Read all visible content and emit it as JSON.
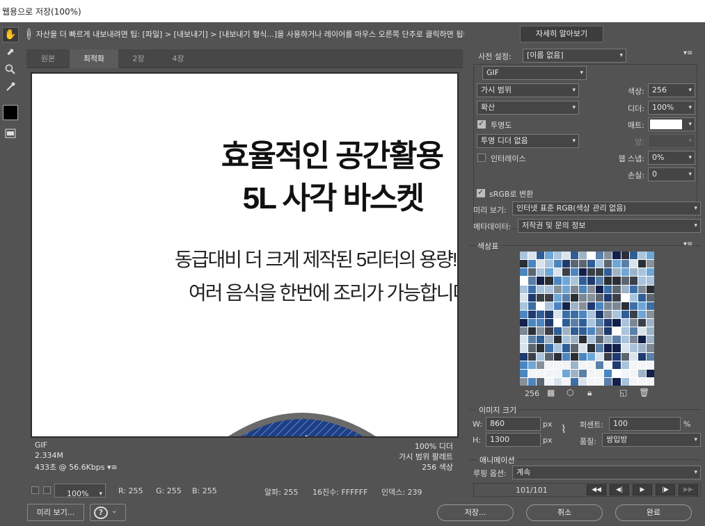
{
  "window": {
    "title": "웹용으로 저장(100%)"
  },
  "tip": {
    "text": "자산을 더 빠르게 내보내려면 팁: [파일] > [내보내기] > [내보내기 형식...]을 사용하거나 레이어를 마우스 오른쪽 단추로 클릭하면 됩니다.",
    "learn_more": "자세히 알아보기"
  },
  "tabs": [
    "원본",
    "최적화",
    "2장",
    "4장"
  ],
  "canvas": {
    "line1": "효율적인 공간활용",
    "line2": "5L 사각 바스켓",
    "line3": "동급대비 더 크게 제작된 5리터의 용량!",
    "line4": "여러 음식을 한번에 조리가 가능합니다"
  },
  "canvas_footer": {
    "format": "GIF",
    "size": "2.334M",
    "time": "433초 @ 56.6Kbps",
    "dither": "100% 디더",
    "palette": "가시 범위 팔레트",
    "colors": "256 색상"
  },
  "status": {
    "zoom": "100%",
    "r": "R: 255",
    "g": "G: 255",
    "b": "B: 255",
    "alpha": "알파: 255",
    "hex": "16진수: FFFFFF",
    "index": "인덱스: 239"
  },
  "settings": {
    "preset_label": "사전 설정:",
    "preset_value": "[이름 없음]",
    "format": "GIF",
    "reduction": "가시 범위",
    "dither_algo": "확산",
    "colors_label": "색상:",
    "colors_value": "256",
    "dither_label": "디더:",
    "dither_value": "100%",
    "transparency_label": "투명도",
    "matte_label": "매트:",
    "trans_dither": "투명 디더 없음",
    "amount_label": "양:",
    "interlace_label": "인터레이스",
    "websnap_label": "웹 스냅:",
    "websnap_value": "0%",
    "lossy_label": "손실:",
    "lossy_value": "0",
    "srgb_label": "sRGB로 변환",
    "preview_label": "미리 보기:",
    "preview_value": "인터넷 표준 RGB(색상 관리 없음)",
    "metadata_label": "메타데이터:",
    "metadata_value": "저작권 및 문의 정보"
  },
  "color_table": {
    "title": "색상표",
    "count": "256"
  },
  "image_size": {
    "title": "이미지 크기",
    "w_label": "W:",
    "w_value": "860",
    "h_label": "H:",
    "h_value": "1300",
    "unit": "px",
    "percent_label": "퍼센트:",
    "percent_value": "100",
    "percent_unit": "%",
    "quality_label": "품질:",
    "quality_value": "쌍입방"
  },
  "animation": {
    "title": "애니메이션",
    "loop_label": "루핑 옵션:",
    "loop_value": "계속",
    "frame": "101/101"
  },
  "buttons": {
    "preview": "미리 보기...",
    "save": "저장...",
    "cancel": "취소",
    "done": "완료"
  },
  "palette_colors": [
    "#1e3a6e",
    "#2f5e96",
    "#4b86c0",
    "#6ea7d6",
    "#87919c",
    "#3a3f48",
    "#5a7fa8",
    "#a9c4dc",
    "#d9e3ec",
    "#ffffff",
    "#2a2e35",
    "#7b8794",
    "#12204a",
    "#3c6fa8",
    "#9fb3c6",
    "#5c6670"
  ]
}
